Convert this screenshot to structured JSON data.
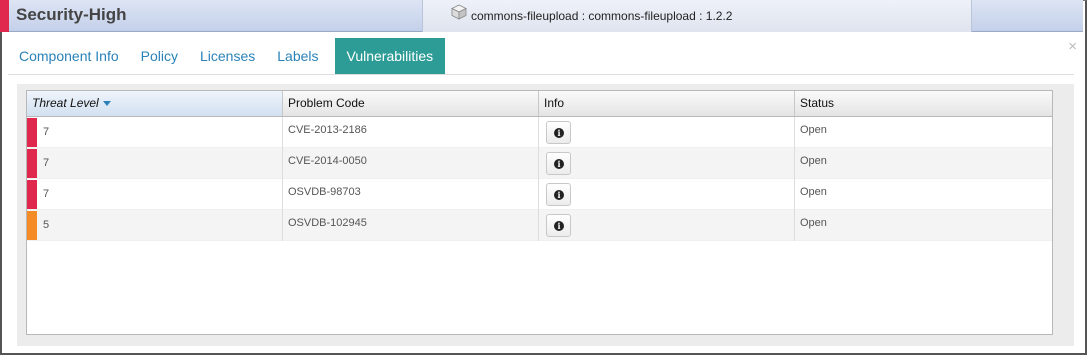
{
  "header": {
    "title": "Security-High",
    "component": "commons-fileupload : commons-fileupload : 1.2.2",
    "component_icon": "package-box-icon",
    "severity_color": "#e0284f",
    "close": "×"
  },
  "tabs": [
    {
      "label": "Component Info"
    },
    {
      "label": "Policy"
    },
    {
      "label": "Licenses"
    },
    {
      "label": "Labels"
    },
    {
      "label": "Vulnerabilities",
      "active": true
    }
  ],
  "grid": {
    "columns": [
      "Threat Level",
      "Problem Code",
      "Info",
      "Status"
    ],
    "sorted_column": "Threat Level",
    "rows": [
      {
        "threat": "7",
        "color": "#e0284f",
        "code": "CVE-2013-2186",
        "status": "Open"
      },
      {
        "threat": "7",
        "color": "#e0284f",
        "code": "CVE-2014-0050",
        "status": "Open"
      },
      {
        "threat": "7",
        "color": "#e0284f",
        "code": "OSVDB-98703",
        "status": "Open"
      },
      {
        "threat": "5",
        "color": "#f58b27",
        "code": "OSVDB-102945",
        "status": "Open"
      }
    ],
    "info_icon": "info-icon"
  }
}
